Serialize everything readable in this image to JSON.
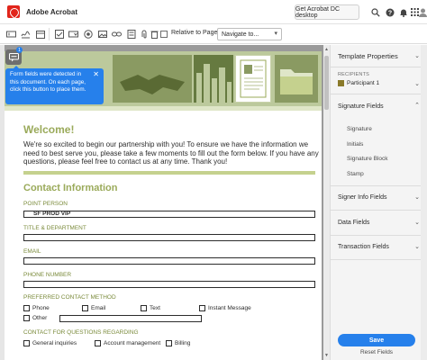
{
  "app": {
    "title": "Adobe Acrobat",
    "get_button": "Get Acrobat DC desktop"
  },
  "titlebar_icons": [
    "search-icon",
    "help-icon",
    "notifications-icon",
    "apps-grid-icon",
    "user-avatar-icon"
  ],
  "toolbar": {
    "tools": [
      "text-field-icon",
      "signature-field-icon",
      "date-field-icon",
      "checkbox-icon",
      "dropdown-icon",
      "radio-icon",
      "image-icon",
      "link-icon",
      "calculator-icon",
      "attachment-icon",
      "delete-icon"
    ],
    "relative_to_page": "Relative to Page",
    "navigate": "Navigate to..."
  },
  "notification": {
    "badge": "1",
    "text": "Form fields were detected in this document. On each page, click this button to place them."
  },
  "form": {
    "welcome": "Welcome!",
    "intro": "We're so excited to begin our partnership with you! To ensure we have the information we need to best serve you, please take a few moments to fill out the form below. If you have any questions, please feel free to contact us at any time. Thank you!",
    "section": "Contact Information",
    "fields": {
      "point_person_label": "POINT PERSON",
      "point_person_value": "SF PROD VIP",
      "title_label": "TITLE & DEPARTMENT",
      "email_label": "EMAIL",
      "phone_label": "PHONE NUMBER",
      "pref_label": "PREFERRED CONTACT METHOD",
      "contact_label": "CONTACT FOR QUESTIONS REGARDING"
    },
    "pref_options": [
      "Phone",
      "Email",
      "Text",
      "Instant Message",
      "Other"
    ],
    "regarding_options": [
      "General inquiries",
      "Account management",
      "Billing"
    ]
  },
  "panel": {
    "title": "Template Properties",
    "recipients_label": "RECIPIENTS",
    "participant": "Participant 1",
    "participant_color": "#8a7a2a",
    "signature_fields": "Signature Fields",
    "signature_items": [
      "Signature",
      "Initials",
      "Signature Block",
      "Stamp"
    ],
    "signer_info": "Signer Info Fields",
    "data_fields": "Data Fields",
    "transaction_fields": "Transaction Fields",
    "save": "Save",
    "reset": "Reset Fields"
  },
  "colors": {
    "accent": "#2680eb",
    "form_green": "#9aaa5a"
  }
}
